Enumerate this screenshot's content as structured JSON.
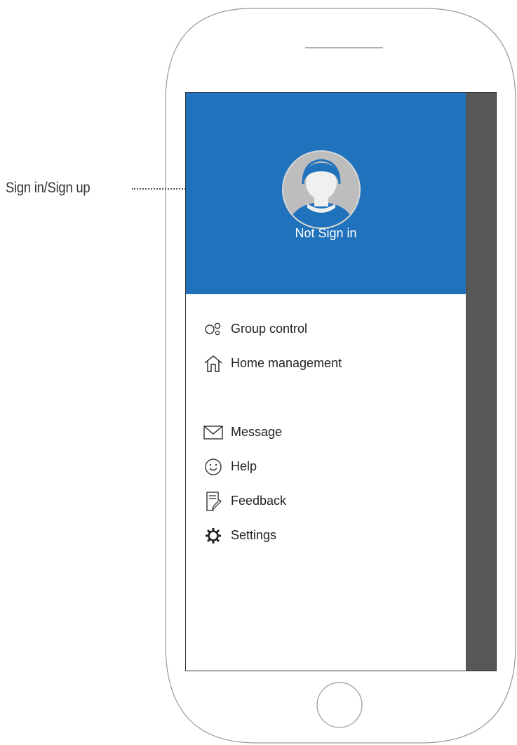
{
  "annotation": {
    "callout_label": "Sign in/Sign up"
  },
  "drawer": {
    "header": {
      "status_text": "Not Sign in",
      "background_color": "#1f72bb"
    },
    "menu_groups": [
      [
        {
          "label": "Group control",
          "icon": "group-control-icon"
        },
        {
          "label": "Home management",
          "icon": "home-icon"
        }
      ],
      [
        {
          "label": "Message",
          "icon": "envelope-icon"
        },
        {
          "label": "Help",
          "icon": "smiley-icon"
        },
        {
          "label": "Feedback",
          "icon": "feedback-icon"
        },
        {
          "label": "Settings",
          "icon": "gear-icon"
        }
      ]
    ]
  },
  "colors": {
    "scrim": "#575757",
    "avatar_fill": "#bdbdbd",
    "avatar_accent": "#1f72bb"
  }
}
